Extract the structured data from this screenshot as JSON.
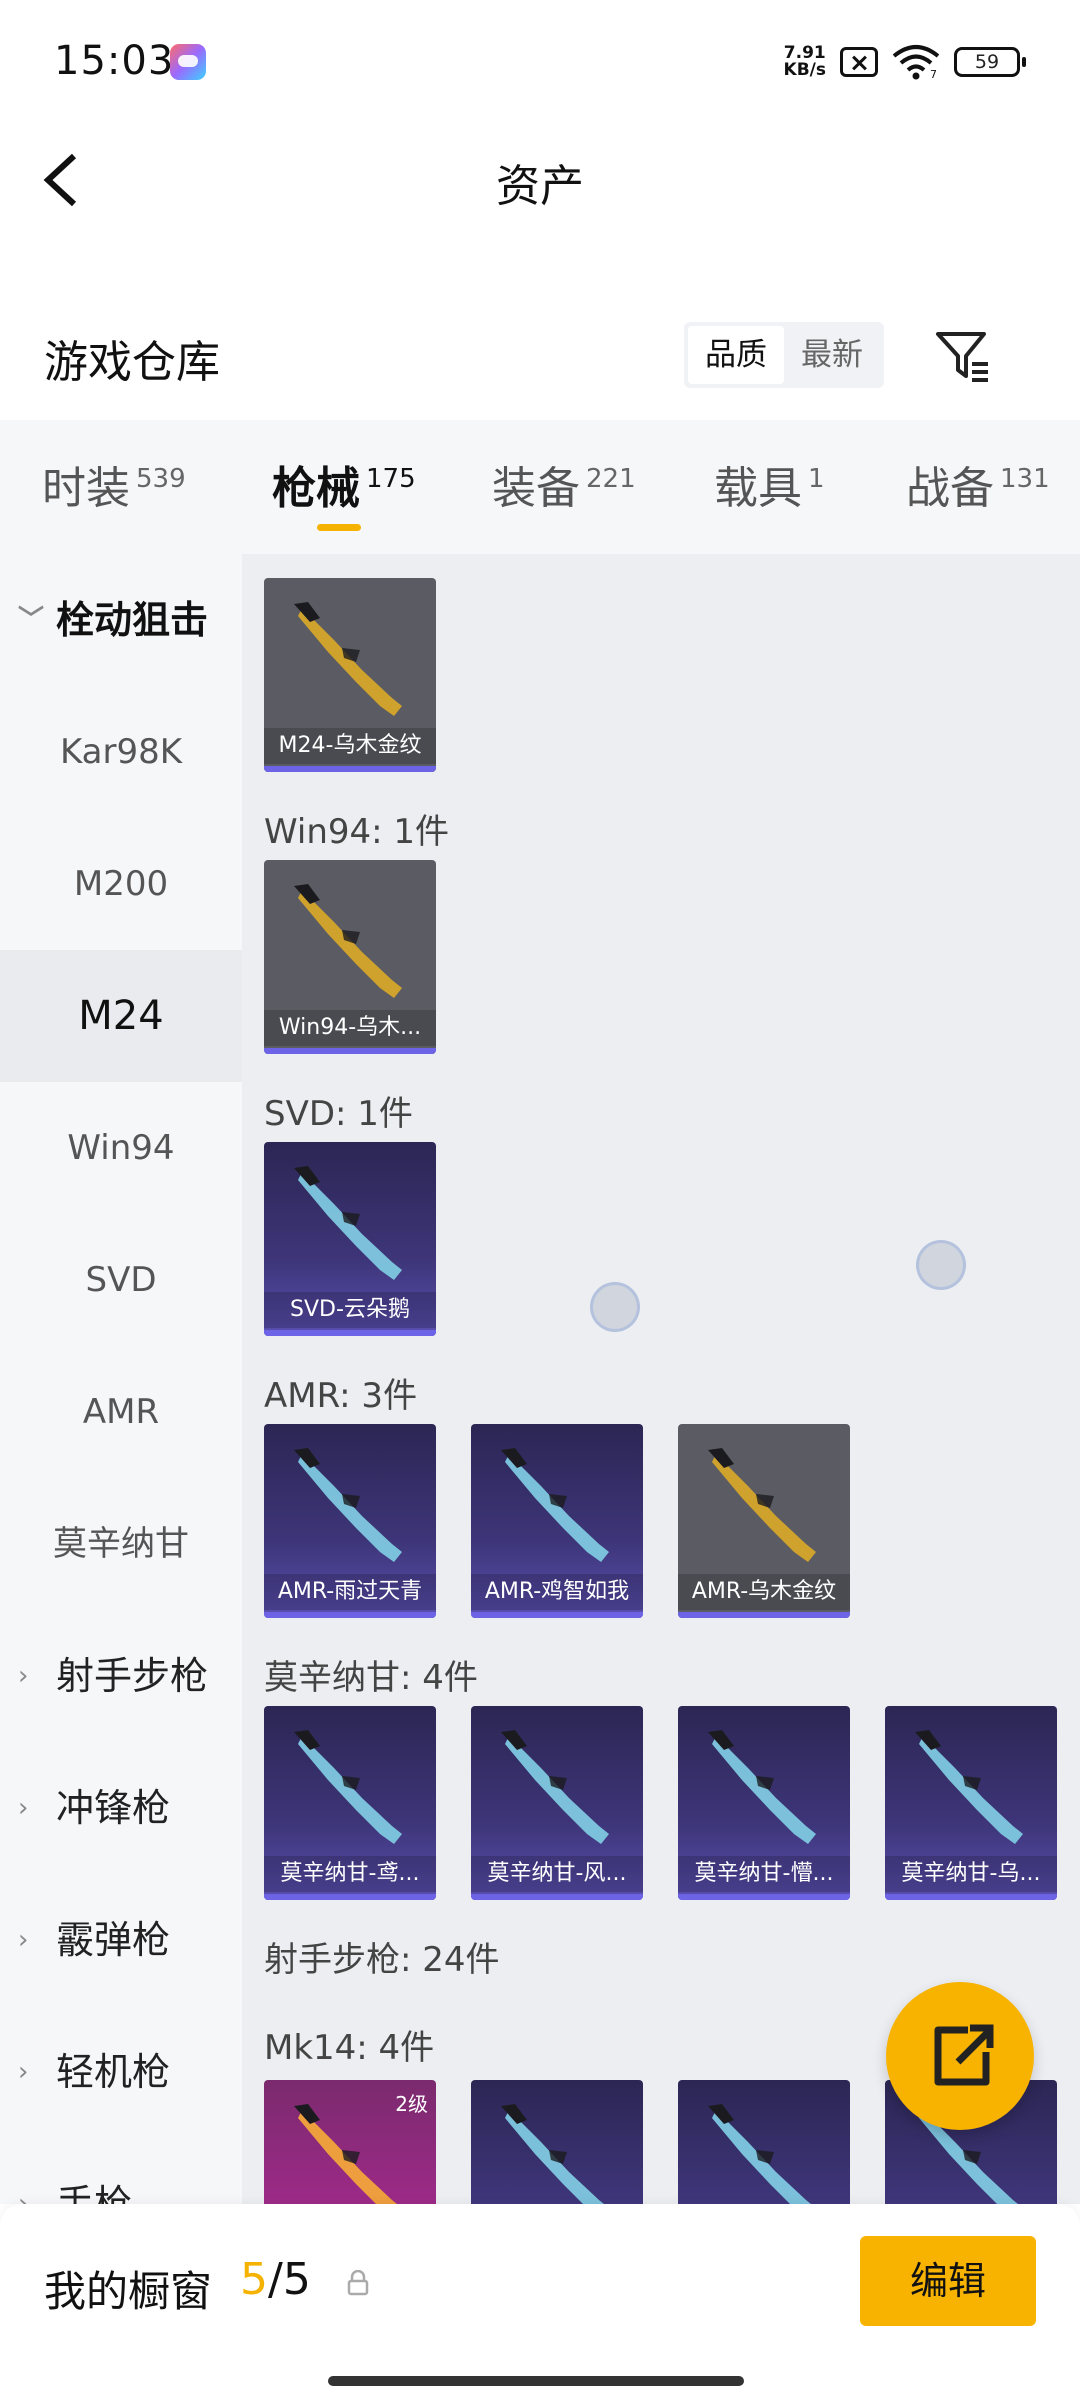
{
  "status_bar": {
    "time": "15:03",
    "net_speed_value": "7.91",
    "net_speed_unit": "KB/s",
    "wifi_badge": "7",
    "battery": "59",
    "icons": [
      "game-center-icon",
      "sim-off-icon",
      "wifi-icon",
      "battery-icon"
    ]
  },
  "header": {
    "title": "资产",
    "back_icon": "chevron-left-icon"
  },
  "warehouse": {
    "title": "游戏仓库",
    "sort_options": [
      "品质",
      "最新"
    ],
    "sort_selected": "品质",
    "filter_icon": "filter-list-icon"
  },
  "category_tabs": [
    {
      "label": "时装",
      "count": "539"
    },
    {
      "label": "枪械",
      "count": "175",
      "active": true
    },
    {
      "label": "装备",
      "count": "221"
    },
    {
      "label": "载具",
      "count": "1"
    },
    {
      "label": "战备",
      "count": "131"
    }
  ],
  "sidebar": {
    "group_open": "栓动狙击",
    "items": [
      "Kar98K",
      "M200",
      "M24",
      "Win94",
      "SVD",
      "AMR",
      "莫辛纳甘"
    ],
    "active_item": "M24",
    "groups_collapsed": [
      "射手步枪",
      "冲锋枪",
      "霰弹枪",
      "轻机枪",
      "手枪"
    ]
  },
  "content": {
    "sections": [
      {
        "label": "",
        "items": [
          {
            "name": "M24-乌木金纹",
            "rarity": "grey"
          }
        ]
      },
      {
        "label": "Win94: 1件",
        "items": [
          {
            "name": "Win94-乌木...",
            "rarity": "grey"
          }
        ]
      },
      {
        "label": "SVD: 1件",
        "items": [
          {
            "name": "SVD-云朵鹅",
            "rarity": "purple"
          }
        ]
      },
      {
        "label": "AMR: 3件",
        "items": [
          {
            "name": "AMR-雨过天青",
            "rarity": "purple"
          },
          {
            "name": "AMR-鸡智如我",
            "rarity": "purple"
          },
          {
            "name": "AMR-乌木金纹",
            "rarity": "grey"
          }
        ]
      },
      {
        "label": "莫辛纳甘: 4件",
        "items": [
          {
            "name": "莫辛纳甘-鸢...",
            "rarity": "purple"
          },
          {
            "name": "莫辛纳甘-风...",
            "rarity": "purple"
          },
          {
            "name": "莫辛纳甘-懵...",
            "rarity": "purple"
          },
          {
            "name": "莫辛纳甘-乌...",
            "rarity": "purple"
          }
        ]
      },
      {
        "label": "射手步枪: 24件",
        "items": []
      },
      {
        "label": "Mk14: 4件",
        "items": [
          {
            "name": "",
            "rarity": "pink",
            "level": "2级"
          },
          {
            "name": "",
            "rarity": "purple"
          },
          {
            "name": "",
            "rarity": "purple"
          },
          {
            "name": "",
            "rarity": "purple"
          }
        ]
      }
    ],
    "fab_icon": "share-external-icon"
  },
  "bottom_bar": {
    "label": "我的橱窗",
    "current": "5",
    "separator": "/",
    "total": "5",
    "lock_icon": "lock-icon",
    "edit_label": "编辑"
  },
  "colors": {
    "accent": "#f7b300",
    "rarity_purple": "#3d3578",
    "rarity_grey": "#5b5c63",
    "rarity_pink": "#9b2a86"
  }
}
